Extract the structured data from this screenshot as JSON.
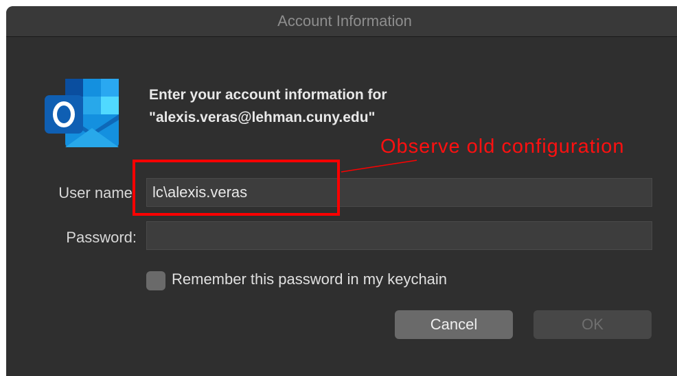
{
  "window": {
    "title": "Account Information"
  },
  "prompt": {
    "line1": "Enter your account information for",
    "line2": "\"alexis.veras@lehman.cuny.edu\""
  },
  "annotation": {
    "text": "Observe old configuration",
    "color": "#ff0000"
  },
  "form": {
    "username_label": "User name:",
    "username_value": "lc\\alexis.veras",
    "password_label": "Password:",
    "password_value": "",
    "remember_label": "Remember this password in my keychain",
    "remember_checked": false
  },
  "buttons": {
    "cancel_label": "Cancel",
    "ok_label": "OK",
    "ok_enabled": false
  },
  "icons": {
    "app_logo": "outlook-icon"
  },
  "colors": {
    "dialog_bg": "#2f2f2f",
    "outlook_blue": "#0f6cbd"
  }
}
